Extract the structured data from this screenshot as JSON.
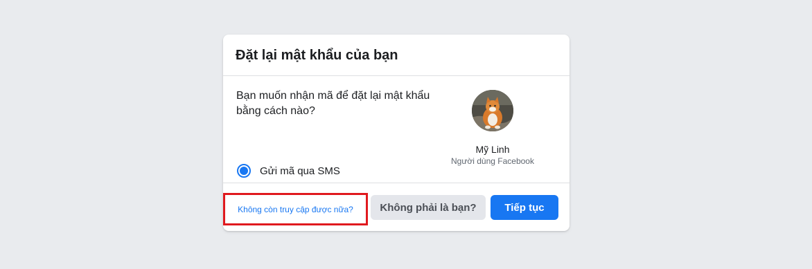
{
  "dialog": {
    "title": "Đặt lại mật khẩu của bạn",
    "question": "Bạn muốn nhận mã để đặt lại mật khẩu bằng cách nào?",
    "options": [
      {
        "label": "Gửi mã qua SMS",
        "selected": true
      }
    ],
    "profile": {
      "name": "Mỹ Linh",
      "subtitle": "Người dùng Facebook"
    },
    "footer": {
      "no_access_link": "Không còn truy cập được nữa?",
      "not_you_button": "Không phải là bạn?",
      "continue_button": "Tiếp tục"
    }
  },
  "colors": {
    "primary": "#1877f2",
    "highlight_box": "#e0191e",
    "background": "#e9ebee"
  },
  "icons": {
    "radio": "radio-selected-icon",
    "avatar": "cat-avatar-photo"
  }
}
